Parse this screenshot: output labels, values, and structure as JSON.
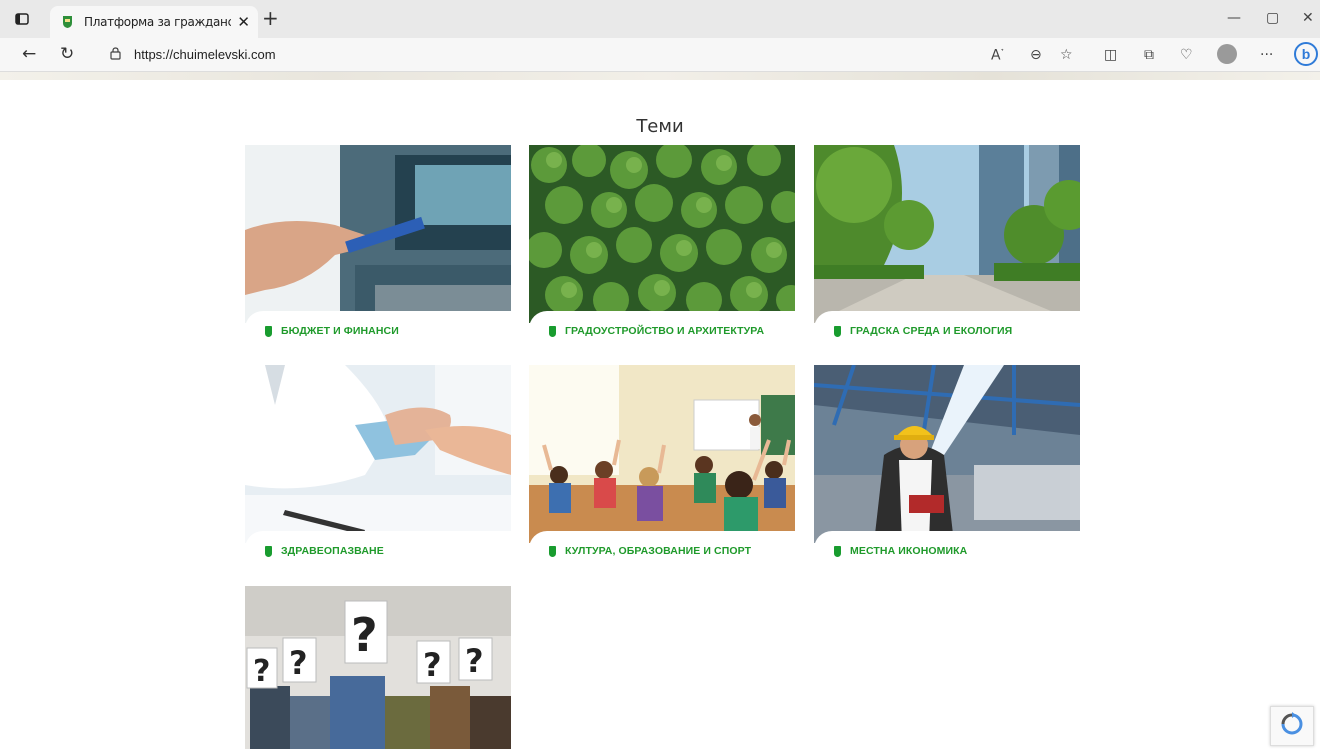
{
  "browser": {
    "tab_title": "Платформа за гражданско учас",
    "url": "https://chuimelevski.com"
  },
  "page": {
    "section_title": "Теми"
  },
  "topics": [
    {
      "label": "БЮДЖЕТ И ФИНАНСИ"
    },
    {
      "label": "ГРАДОУСТРОЙСТВО И АРХИТЕКТУРА"
    },
    {
      "label": "ГРАДСКА СРЕДА И ЕКОЛОГИЯ"
    },
    {
      "label": "ЗДРАВЕОПАЗВАНЕ"
    },
    {
      "label": "КУЛТУРА, ОБРАЗОВАНИЕ И СПОРТ"
    },
    {
      "label": "МЕСТНА ИКОНОМИКА"
    }
  ],
  "colors": {
    "accent": "#1f9a2b",
    "tabbar": "#e9e9e9",
    "toolbar": "#f7f7f7"
  }
}
